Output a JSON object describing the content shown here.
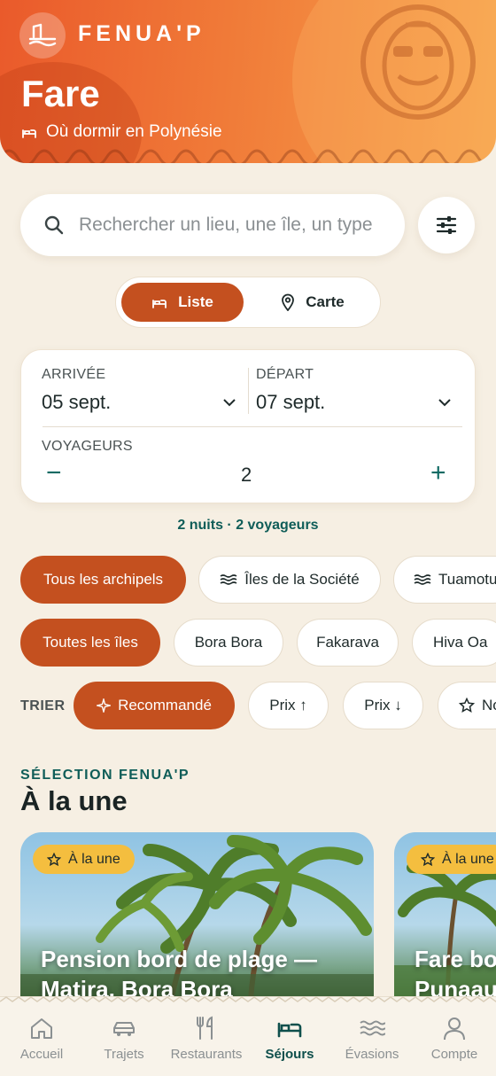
{
  "header": {
    "brand": "FENUA'P",
    "title": "Fare",
    "subtitle": "Où dormir en Polynésie"
  },
  "search": {
    "placeholder": "Rechercher un lieu, une île, un type"
  },
  "view_toggle": {
    "list_label": "Liste",
    "map_label": "Carte",
    "selected": "Liste"
  },
  "booking": {
    "arrival_label": "ARRIVÉE",
    "arrival_value": "05 sept.",
    "departure_label": "DÉPART",
    "departure_value": "07 sept.",
    "travelers_label": "VOYAGEURS",
    "travelers_value": "2",
    "summary": "2 nuits · 2 voyageurs"
  },
  "archipelagos": [
    "Tous les archipels",
    "Îles de la Société",
    "Tuamotu"
  ],
  "islands": [
    "Toutes les îles",
    "Bora Bora",
    "Fakarava",
    "Hiva Oa"
  ],
  "sort": {
    "label": "TRIER",
    "options": [
      "Recommandé",
      "Prix ↑",
      "Prix ↓",
      "No"
    ]
  },
  "featured": {
    "kicker": "SÉLECTION FENUA'P",
    "title": "À la une",
    "cards": [
      {
        "badge": "À la une",
        "title_line1": "Pension bord de plage —",
        "title_line2": "Matira, Bora Bora"
      },
      {
        "badge": "À la une",
        "title_line1": "Fare bo",
        "title_line2": "Punaau"
      }
    ]
  },
  "nav": {
    "items": [
      "Accueil",
      "Trajets",
      "Restaurants",
      "Séjours",
      "Évasions",
      "Compte"
    ],
    "active": "Séjours"
  },
  "colors": {
    "accent": "#c4501f",
    "teal": "#0f5d58",
    "badge": "#f4be3f",
    "background": "#f6efe3"
  }
}
